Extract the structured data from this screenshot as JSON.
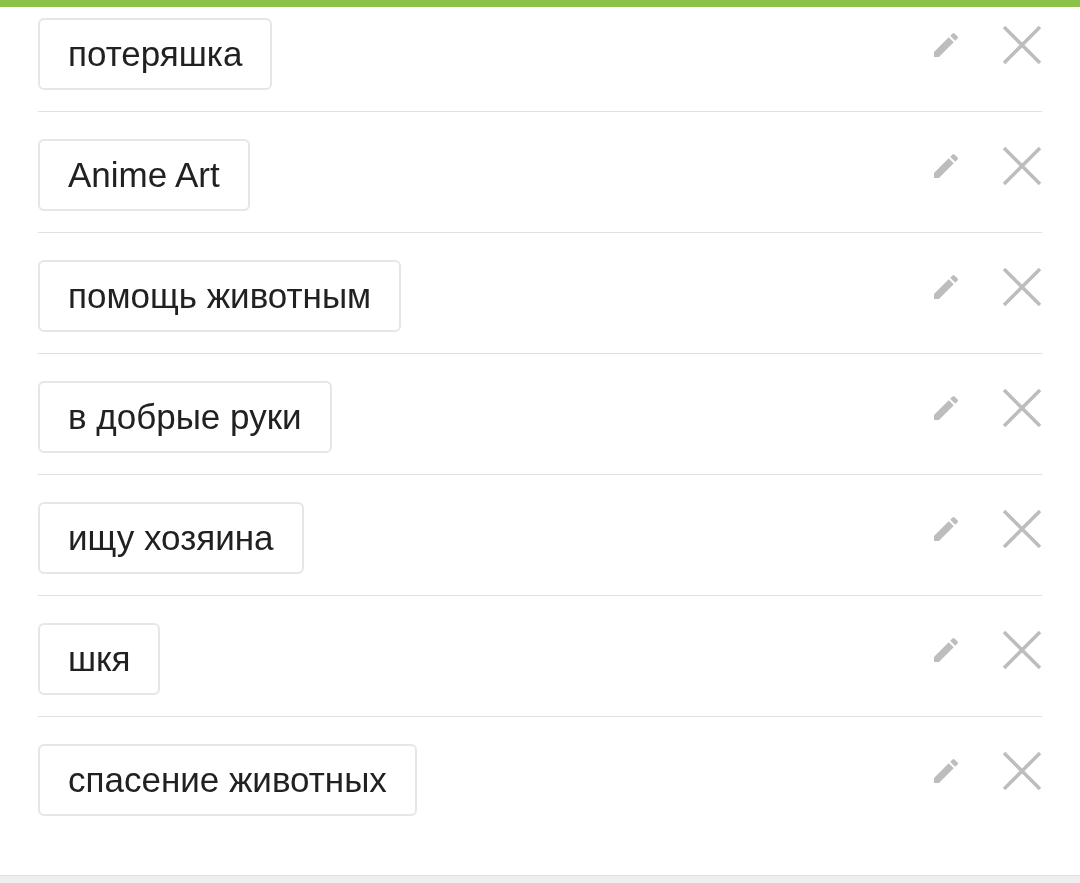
{
  "tags": [
    {
      "label": "потеряшка"
    },
    {
      "label": "Anime Art"
    },
    {
      "label": "помощь животным"
    },
    {
      "label": "в добрые руки"
    },
    {
      "label": "ищу хозяина"
    },
    {
      "label": "шкя"
    },
    {
      "label": "спасение животных"
    }
  ]
}
